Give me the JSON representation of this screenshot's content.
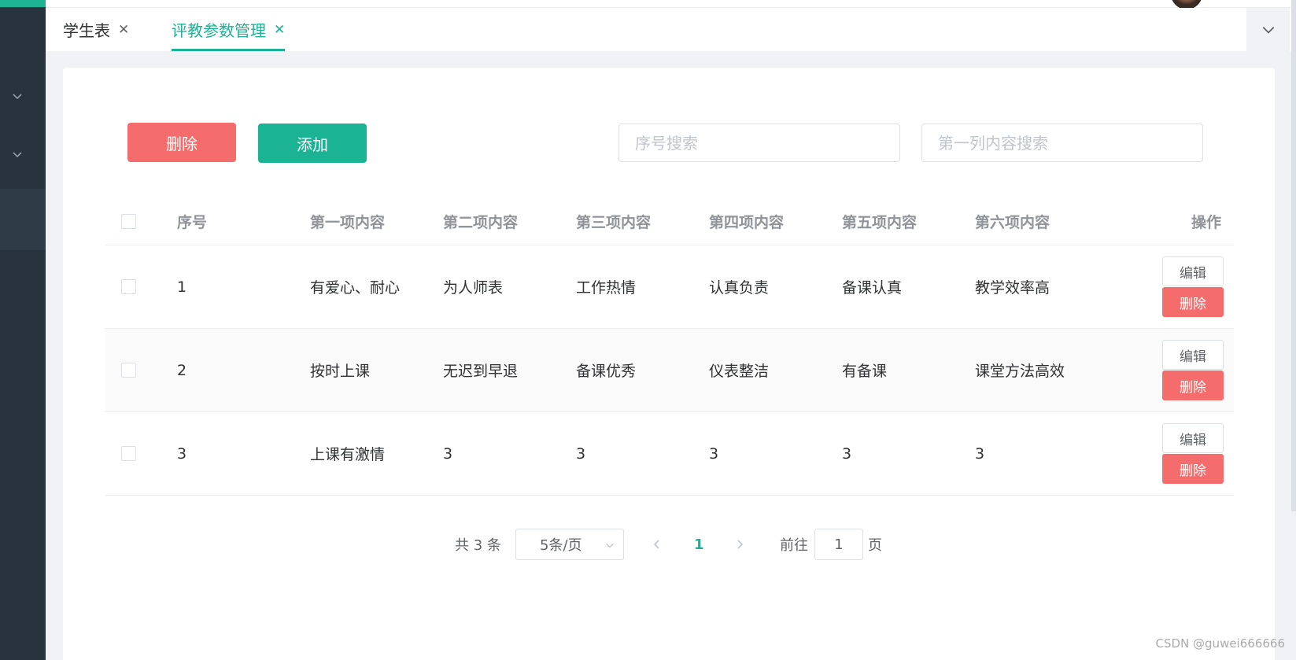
{
  "tabs": [
    {
      "label": "学生表",
      "active": false
    },
    {
      "label": "评教参数管理",
      "active": true
    }
  ],
  "toolbar": {
    "delete_label": "删除",
    "add_label": "添加"
  },
  "search": {
    "id_placeholder": "序号搜索",
    "content_placeholder": "第一列内容搜索"
  },
  "table": {
    "headers": [
      "序号",
      "第一项内容",
      "第二项内容",
      "第三项内容",
      "第四项内容",
      "第五项内容",
      "第六项内容",
      "操作"
    ],
    "rows": [
      [
        "1",
        "有爱心、耐心",
        "为人师表",
        "工作热情",
        "认真负责",
        "备课认真",
        "教学效率高"
      ],
      [
        "2",
        "按时上课",
        "无迟到早退",
        "备课优秀",
        "仪表整洁",
        "有备课",
        "课堂方法高效"
      ],
      [
        "3",
        "上课有激情",
        "3",
        "3",
        "3",
        "3",
        "3"
      ]
    ],
    "edit_label": "编辑",
    "delete_label": "删除"
  },
  "pagination": {
    "total_text": "共 3 条",
    "page_size": "5条/页",
    "current_page": "1",
    "goto_label": "前往",
    "goto_value": "1",
    "page_suffix": "页"
  },
  "watermark": "CSDN @guwei666666",
  "colors": {
    "accent": "#1ab394",
    "danger": "#f56c6c",
    "sidebar": "#28333e"
  }
}
